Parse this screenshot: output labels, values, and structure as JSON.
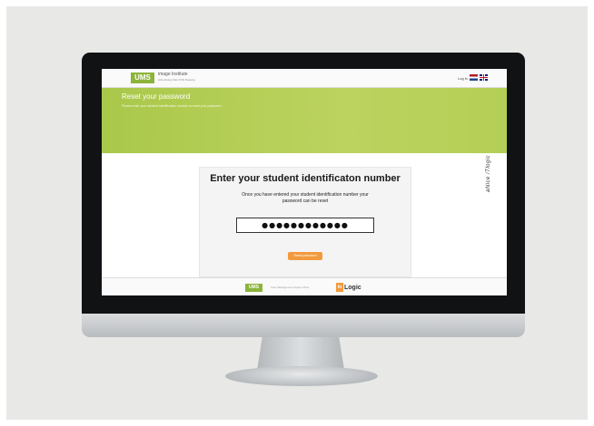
{
  "header": {
    "logo_text": "UMS",
    "brand_title": "image Institute",
    "brand_subtitle": "Advertising NHL 3794 Peasing",
    "login_label": "Log in",
    "language_flags": [
      "flag-nl",
      "flag-uk"
    ]
  },
  "banner": {
    "title": "Reset your password",
    "subtitle": "Please enter your student identification number to reset your password",
    "color": "#b4cf55"
  },
  "form": {
    "title": "Enter your student identificaton number",
    "instruction": "Once you have entered your student identification number your password can be reset",
    "input_value": "●●●●●●●●●●●●",
    "button_label": "Reset password",
    "button_color": "#f29a3d"
  },
  "footer": {
    "logo_text": "UMS",
    "tagline": "User Management System Plus",
    "partner_mark": "In",
    "partner_name": "Logic"
  },
  "watermark": "aNice /Tlogic"
}
